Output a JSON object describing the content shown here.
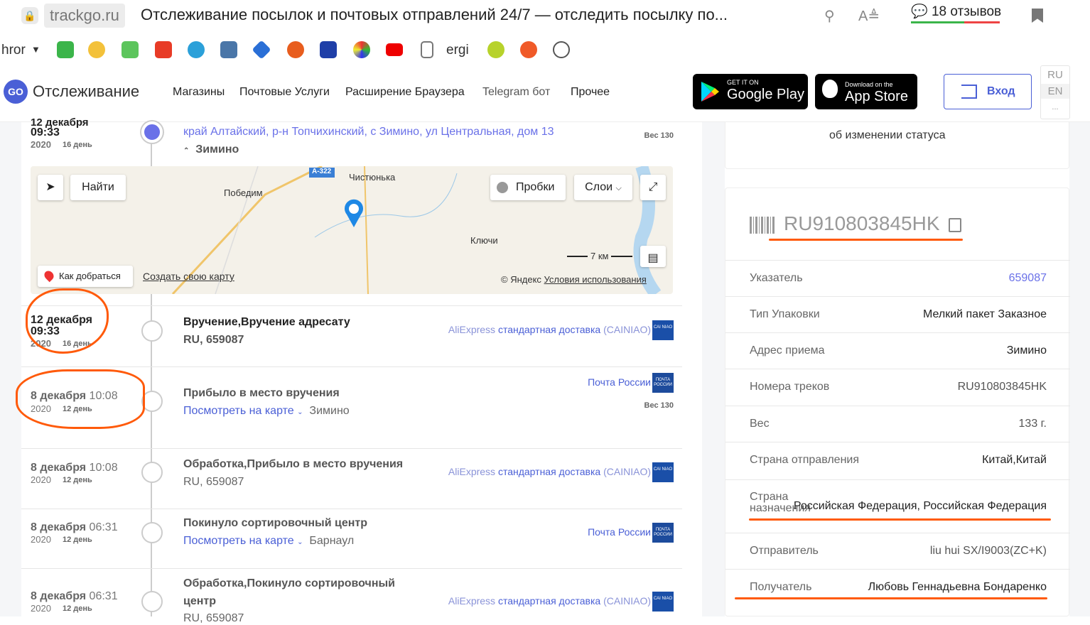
{
  "browser": {
    "domain": "trackgo.ru",
    "tab_title": "Отслеживание посылок и почтовых отправлений 24/7 — отследить посылку по...",
    "reviews": "18 отзывов",
    "bookmarks": {
      "left_text": "hror",
      "ergi": "ergi"
    }
  },
  "site": {
    "logo_badge": "GO",
    "logo_text": "Отслеживание",
    "nav": [
      "Магазины",
      "Почтовые Услуги",
      "Расширение Браузера",
      "Telegram бот",
      "Прочее"
    ],
    "google_small": "GET IT ON",
    "google_big": "Google Play",
    "apple_small": "Download on the",
    "apple_big": "App Store",
    "login": "Вход",
    "lang": [
      "RU",
      "EN",
      "..."
    ]
  },
  "current_event": {
    "date": "12 декабря",
    "time": "09:33",
    "year": "2020",
    "day": "16 день",
    "address": "край Алтайский, р-н Топчихинский, с Зимино, ул Центральная, дом 13",
    "place": "Зимино",
    "weight": "Вес 130"
  },
  "map": {
    "find": "Найти",
    "traffic": "Пробки",
    "layers": "Слои",
    "route": "Как добраться",
    "create": "Создать свою карту",
    "scale": "7 км",
    "copyright": "© Яндекс",
    "terms": "Условия использования",
    "places": [
      "Чистюнька",
      "Победим",
      "Ключи",
      "А-322"
    ]
  },
  "events": [
    {
      "date": "12 декабря",
      "time": "09:33",
      "year": "2020",
      "day": "16 день",
      "title": "Вручение,Вручение адресату",
      "sub": "RU, 659087",
      "carrier_grey": "AliExpress",
      "carrier": "стандартная доставка",
      "carrier_tail": "(CAINIAO)",
      "logo": "CAI NIAO"
    },
    {
      "date": "8 декабря",
      "time": "10:08",
      "year": "2020",
      "day": "12 день",
      "title": "Прибыло в место вручения",
      "link": "Посмотреть на карте",
      "place": "Зимино",
      "carrier": "Почта России",
      "logo": "ПОЧТА РОССИИ",
      "weight": "Вес 130"
    },
    {
      "date": "8 декабря",
      "time": "10:08",
      "year": "2020",
      "day": "12 день",
      "title": "Обработка,Прибыло в место вручения",
      "sub": "RU, 659087",
      "carrier_grey": "AliExpress",
      "carrier": "стандартная доставка",
      "carrier_tail": "(CAINIAO)",
      "logo": "CAI NIAO"
    },
    {
      "date": "8 декабря",
      "time": "06:31",
      "year": "2020",
      "day": "12 день",
      "title": "Покинуло сортировочный центр",
      "link": "Посмотреть на карте",
      "place": "Барнаул",
      "carrier": "Почта России",
      "logo": "ПОЧТА РОССИИ"
    },
    {
      "date": "8 декабря",
      "time": "06:31",
      "year": "2020",
      "day": "12 день",
      "title": "Обработка,Покинуло сортировочный",
      "title2": "центр",
      "sub": "RU, 659087",
      "carrier_grey": "AliExpress",
      "carrier": "стандартная доставка",
      "carrier_tail": "(CAINIAO)",
      "logo": "CAI NIAO"
    }
  ],
  "status_card": {
    "text": "об изменении статуса"
  },
  "details": {
    "track": "RU910803845HK",
    "rows": [
      {
        "label": "Указатель",
        "value": "659087"
      },
      {
        "label": "Тип Упаковки",
        "value": "Мелкий пакет Заказное"
      },
      {
        "label": "Адрес приема",
        "value": "Зимино"
      },
      {
        "label": "Номера треков",
        "value": "RU910803845HK"
      },
      {
        "label": "Вес",
        "value": "133 г."
      },
      {
        "label": "Страна отправления",
        "value": "Китай,Китай"
      },
      {
        "label": "Страна назначения",
        "value": "Российская Федерация, Российская Федерация"
      },
      {
        "label": "Отправитель",
        "value": "liu hui SX/I9003(ZC+K)"
      },
      {
        "label": "Получатель",
        "value": "Любовь Геннадьевна Бондаренко"
      }
    ]
  },
  "colors": {
    "accent": "#4a5fd6",
    "annotation": "#ff5a0a"
  }
}
